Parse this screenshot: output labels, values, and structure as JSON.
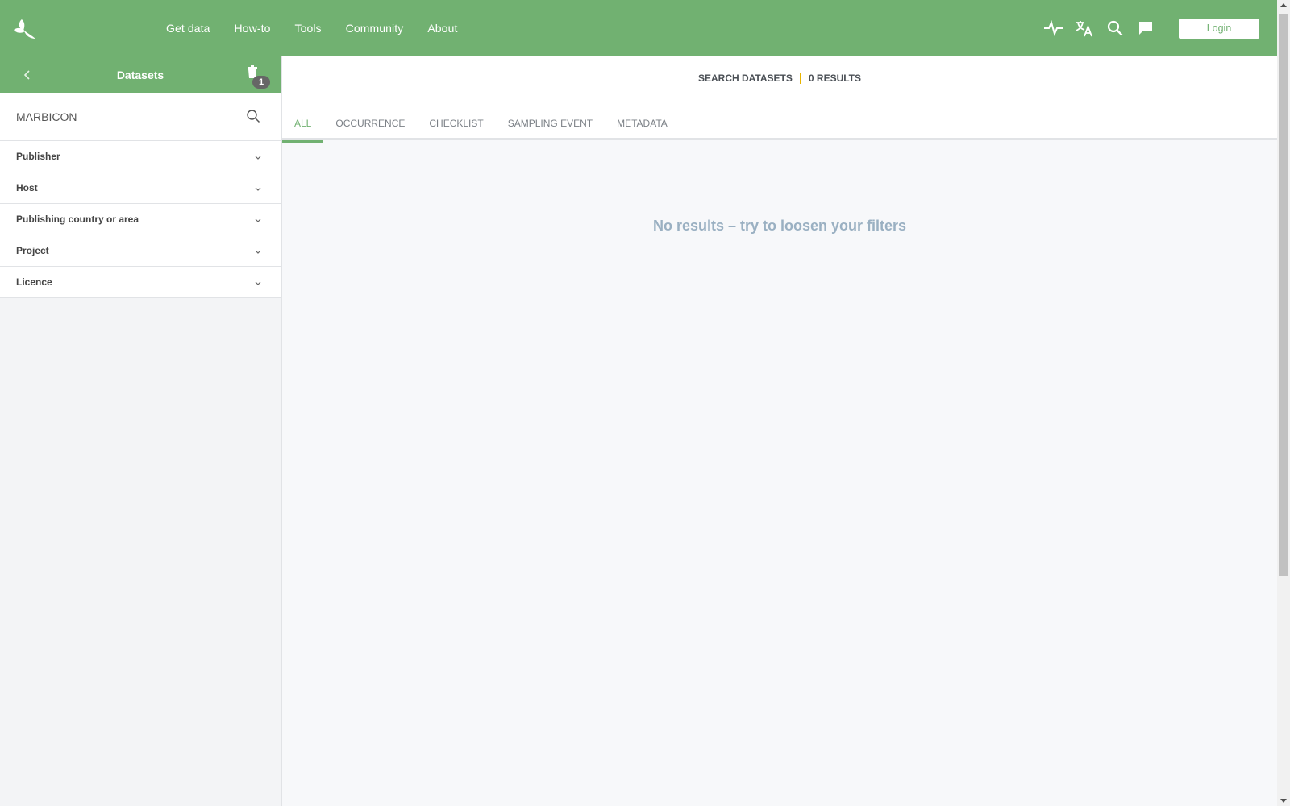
{
  "topbar": {
    "logo_icon": "gbif-leaf-icon",
    "nav": [
      {
        "label": "Get data"
      },
      {
        "label": "How-to"
      },
      {
        "label": "Tools"
      },
      {
        "label": "Community"
      },
      {
        "label": "About"
      }
    ],
    "icons": [
      "health-pulse-icon",
      "translate-icon",
      "search-icon",
      "feedback-comment-icon"
    ],
    "login_label": "Login"
  },
  "sidebar": {
    "title": "Datasets",
    "filter_count": "1",
    "search_value": "MARBICON",
    "filters": [
      {
        "label": "Publisher"
      },
      {
        "label": "Host"
      },
      {
        "label": "Publishing country or area"
      },
      {
        "label": "Project"
      },
      {
        "label": "Licence"
      }
    ]
  },
  "main": {
    "summary_label": "SEARCH DATASETS",
    "results_label": "0 RESULTS",
    "tabs": [
      {
        "label": "ALL"
      },
      {
        "label": "OCCURRENCE"
      },
      {
        "label": "CHECKLIST"
      },
      {
        "label": "SAMPLING EVENT"
      },
      {
        "label": "METADATA"
      }
    ],
    "active_tab": "ALL",
    "empty_message": "No results – try to loosen your filters"
  },
  "colors": {
    "brand_green": "#71b171",
    "accent_yellow": "#e8b400",
    "empty_text": "#9ab0c2"
  }
}
